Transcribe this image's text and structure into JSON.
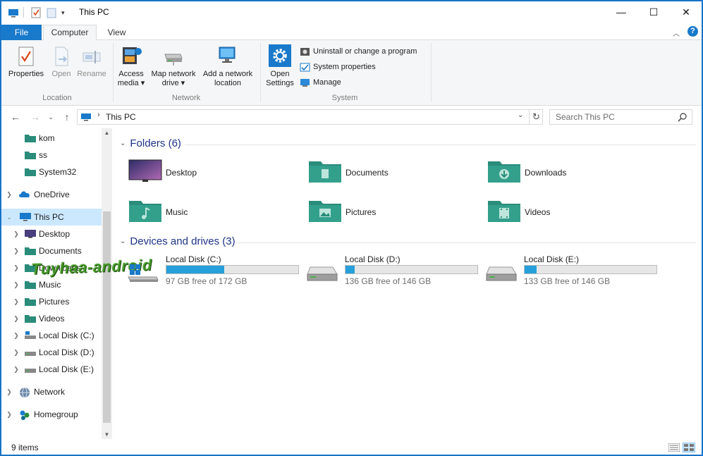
{
  "window": {
    "title": "This PC",
    "quick_access_dropdown": "▾",
    "controls": {
      "minimize": "—",
      "maximize": "☐",
      "close": "✕"
    }
  },
  "tabs": {
    "file": "File",
    "computer": "Computer",
    "view": "View"
  },
  "ribbon": {
    "location": {
      "group": "Location",
      "properties": "Properties",
      "open": "Open",
      "rename": "Rename"
    },
    "network": {
      "group": "Network",
      "access_media_1": "Access",
      "access_media_2": "media ▾",
      "map_drive_1": "Map network",
      "map_drive_2": "drive ▾",
      "add_location_1": "Add a network",
      "add_location_2": "location"
    },
    "system": {
      "group": "System",
      "open_settings_1": "Open",
      "open_settings_2": "Settings",
      "uninstall": "Uninstall or change a program",
      "system_properties": "System properties",
      "manage": "Manage"
    }
  },
  "address": {
    "path": "This PC",
    "search_placeholder": "Search This PC"
  },
  "nav": {
    "items": [
      {
        "label": "kom",
        "icon": "folder-green-icon"
      },
      {
        "label": "ss",
        "icon": "folder-green-icon"
      },
      {
        "label": "System32",
        "icon": "folder-green-icon"
      },
      {
        "label": "OneDrive",
        "icon": "onedrive-icon"
      },
      {
        "label": "This PC",
        "icon": "this-pc-icon",
        "selected": true
      },
      {
        "label": "Desktop",
        "icon": "desktop-icon"
      },
      {
        "label": "Documents",
        "icon": "folder-green-icon"
      },
      {
        "label": "Downloads",
        "icon": "folder-green-icon"
      },
      {
        "label": "Music",
        "icon": "folder-green-icon"
      },
      {
        "label": "Pictures",
        "icon": "folder-green-icon"
      },
      {
        "label": "Videos",
        "icon": "folder-green-icon"
      },
      {
        "label": "Local Disk (C:)",
        "icon": "drive-icon"
      },
      {
        "label": "Local Disk (D:)",
        "icon": "drive-icon"
      },
      {
        "label": "Local Disk (E:)",
        "icon": "drive-icon"
      },
      {
        "label": "Network",
        "icon": "network-icon"
      },
      {
        "label": "Homegroup",
        "icon": "homegroup-icon"
      }
    ]
  },
  "content": {
    "folders_header": "Folders (6)",
    "folders": [
      {
        "label": "Desktop",
        "icon": "desktop-icon"
      },
      {
        "label": "Documents",
        "icon": "documents-folder-icon"
      },
      {
        "label": "Downloads",
        "icon": "downloads-folder-icon"
      },
      {
        "label": "Music",
        "icon": "music-folder-icon"
      },
      {
        "label": "Pictures",
        "icon": "pictures-folder-icon"
      },
      {
        "label": "Videos",
        "icon": "videos-folder-icon"
      }
    ],
    "drives_header": "Devices and drives (3)",
    "drives": [
      {
        "name": "Local Disk (C:)",
        "free": "97 GB free of 172 GB",
        "used_fraction": 0.44
      },
      {
        "name": "Local Disk (D:)",
        "free": "136 GB free of 146 GB",
        "used_fraction": 0.07
      },
      {
        "name": "Local Disk (E:)",
        "free": "133 GB free of 146 GB",
        "used_fraction": 0.09
      }
    ]
  },
  "status": {
    "items": "9 items"
  },
  "watermark": "Tuyhaa-android",
  "colors": {
    "accent": "#1979ca",
    "folder": "#2a8c7a",
    "drive_bar": "#26a0da",
    "selection": "#cce8ff",
    "section_header": "#1e3287"
  }
}
